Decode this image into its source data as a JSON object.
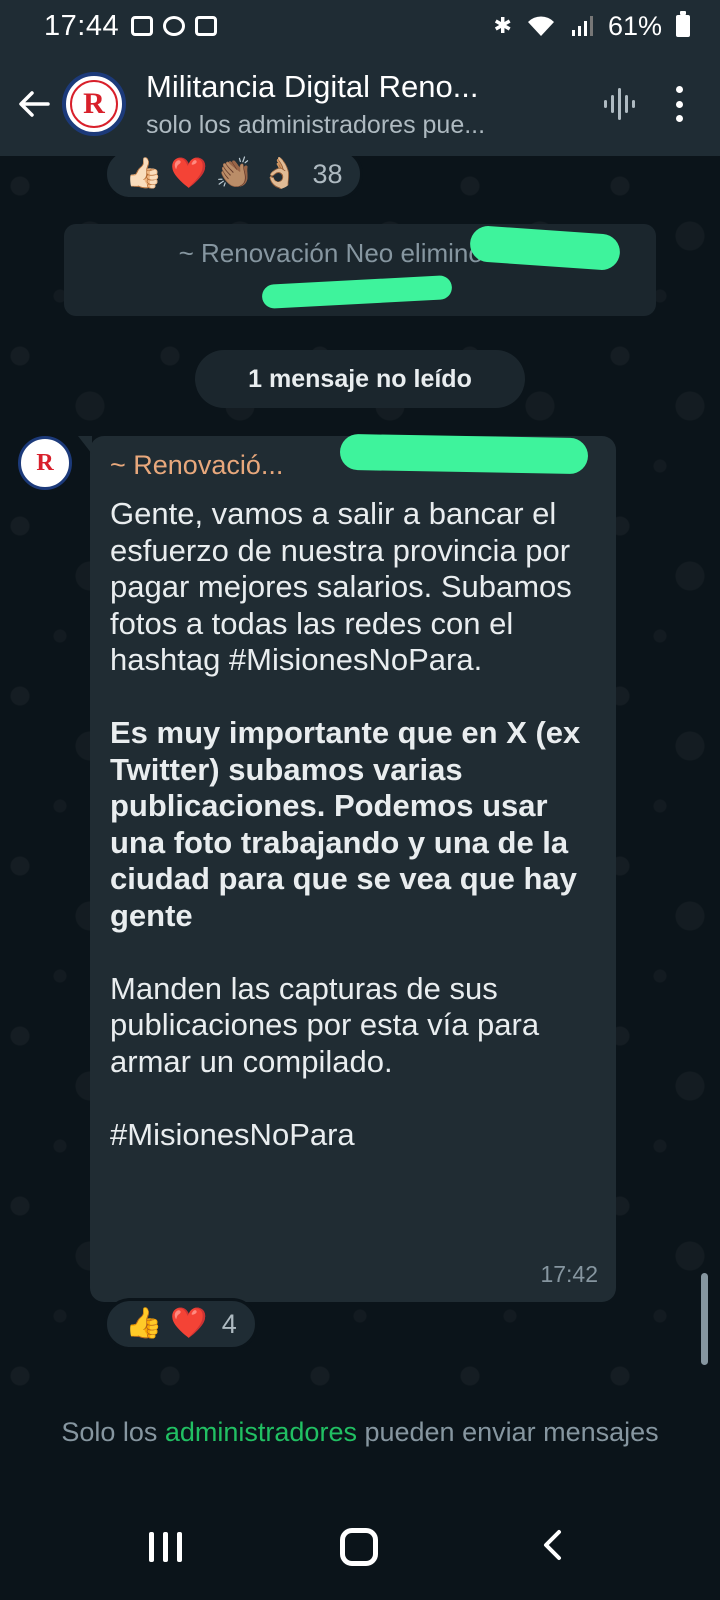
{
  "status_bar": {
    "time": "17:44",
    "battery": "61%",
    "icons": [
      "voicemail-icon",
      "chat-bubble-icon",
      "camera-icon",
      "bluetooth-icon",
      "wifi-icon",
      "signal-icon",
      "battery-icon"
    ]
  },
  "header": {
    "title": "Militancia Digital Reno...",
    "subtitle": "solo los administradores pue...",
    "avatar_letter": "R"
  },
  "top_reactions": {
    "emojis": [
      "👍🏻",
      "❤️",
      "👏🏽",
      "👌🏼"
    ],
    "count": "38"
  },
  "system_message": {
    "text": "~ Renovación Neo eliminó a +5"
  },
  "unread_divider": {
    "text": "1 mensaje no leído"
  },
  "message": {
    "sender": "~ Renovació...",
    "paragraphs": [
      {
        "text": "Gente, vamos a salir a bancar el esfuerzo de nuestra provincia por pagar mejores salarios. Subamos fotos a todas las redes con el hashtag #MisionesNoPara.",
        "bold": false
      },
      {
        "text": "Es muy importante que en X (ex Twitter) subamos varias publicaciones. Podemos usar una foto trabajando y una de la ciudad para que se vea que hay gente",
        "bold": true
      },
      {
        "text": "Manden las capturas  de sus publicaciones por esta vía para armar un compilado.",
        "bold": false
      },
      {
        "text": "#MisionesNoPara",
        "bold": false
      }
    ],
    "time": "17:42"
  },
  "bottom_reactions": {
    "emojis": [
      "👍",
      "❤️"
    ],
    "count": "4"
  },
  "footer": {
    "prefix": "Solo los ",
    "link": "administradores",
    "suffix": " pueden enviar mensajes"
  },
  "colors": {
    "background": "#0b141a",
    "header": "#1f2c34",
    "bubble": "#202c33",
    "sender_name": "#e8a87c",
    "accent_green": "#21c063",
    "redaction": "#3ef39c"
  }
}
